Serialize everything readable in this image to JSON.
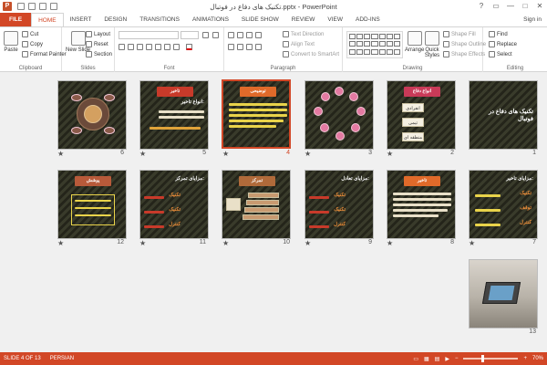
{
  "window": {
    "title": "تکنیک های دفاع در فوتبال.pptx - PowerPoint",
    "app_icon": "P",
    "controls": [
      "?",
      "▭",
      "—",
      "□",
      "✕"
    ]
  },
  "tabs": [
    {
      "label": "FILE",
      "kind": "file"
    },
    {
      "label": "HOME",
      "kind": "active"
    },
    {
      "label": "INSERT"
    },
    {
      "label": "DESIGN"
    },
    {
      "label": "TRANSITIONS"
    },
    {
      "label": "ANIMATIONS"
    },
    {
      "label": "SLIDE SHOW"
    },
    {
      "label": "REVIEW"
    },
    {
      "label": "VIEW"
    },
    {
      "label": "ADD-INS"
    }
  ],
  "signin": "Sign in",
  "ribbon": {
    "clipboard": {
      "label": "Clipboard",
      "paste": "Paste",
      "cut": "Cut",
      "copy": "Copy",
      "format_painter": "Format Painter"
    },
    "slides": {
      "label": "Slides",
      "new_slide": "New Slide",
      "layout": "Layout",
      "reset": "Reset",
      "section": "Section"
    },
    "font": {
      "label": "Font"
    },
    "paragraph": {
      "label": "Paragraph",
      "text_direction": "Text Direction",
      "align_text": "Align Text",
      "convert_smartart": "Convert to SmartArt"
    },
    "drawing": {
      "label": "Drawing",
      "arrange": "Arrange",
      "quick_styles": "Quick Styles",
      "shape_fill": "Shape Fill",
      "shape_outline": "Shape Outline",
      "shape_effects": "Shape Effects"
    },
    "editing": {
      "label": "Editing",
      "find": "Find",
      "replace": "Replace",
      "select": "Select"
    }
  },
  "slides": [
    {
      "n": "1",
      "title": "تکنیک های دفاع در فوتبال",
      "kind": "title"
    },
    {
      "n": "2",
      "banner": "انواع دفاع",
      "kind": "list3",
      "items": [
        "انفرادی",
        "تیمی",
        "منطقه ای"
      ]
    },
    {
      "n": "3",
      "kind": "circles"
    },
    {
      "n": "4",
      "banner": "توضیحی",
      "kind": "text",
      "selected": true
    },
    {
      "n": "5",
      "banner": "تاخیر",
      "kind": "textlight",
      "heading": "انواع تاخیر:"
    },
    {
      "n": "6",
      "kind": "ring"
    },
    {
      "n": "7",
      "heading": "مزایای تاخیر:",
      "kind": "bullets",
      "items": [
        "تکنیک",
        "توقف",
        "کنترل"
      ]
    },
    {
      "n": "8",
      "banner": "تاخیر",
      "kind": "text"
    },
    {
      "n": "9",
      "heading": "مزایای تعادل:",
      "kind": "bullets2",
      "items": [
        "تکنیک",
        "تکنیک",
        "کنترل"
      ]
    },
    {
      "n": "10",
      "banner": "تمرکز",
      "kind": "stack"
    },
    {
      "n": "11",
      "heading": "مزایای تمرکز:",
      "kind": "bullets2",
      "items": [
        "تکنیک",
        "تکنیک",
        "کنترل"
      ]
    },
    {
      "n": "12",
      "banner": "پوشش",
      "kind": "table"
    },
    {
      "n": "13",
      "kind": "photo"
    }
  ],
  "status": {
    "slide_info": "SLIDE 4 OF 13",
    "language": "PERSIAN",
    "zoom": "70%",
    "zoom_level": 0.7
  }
}
